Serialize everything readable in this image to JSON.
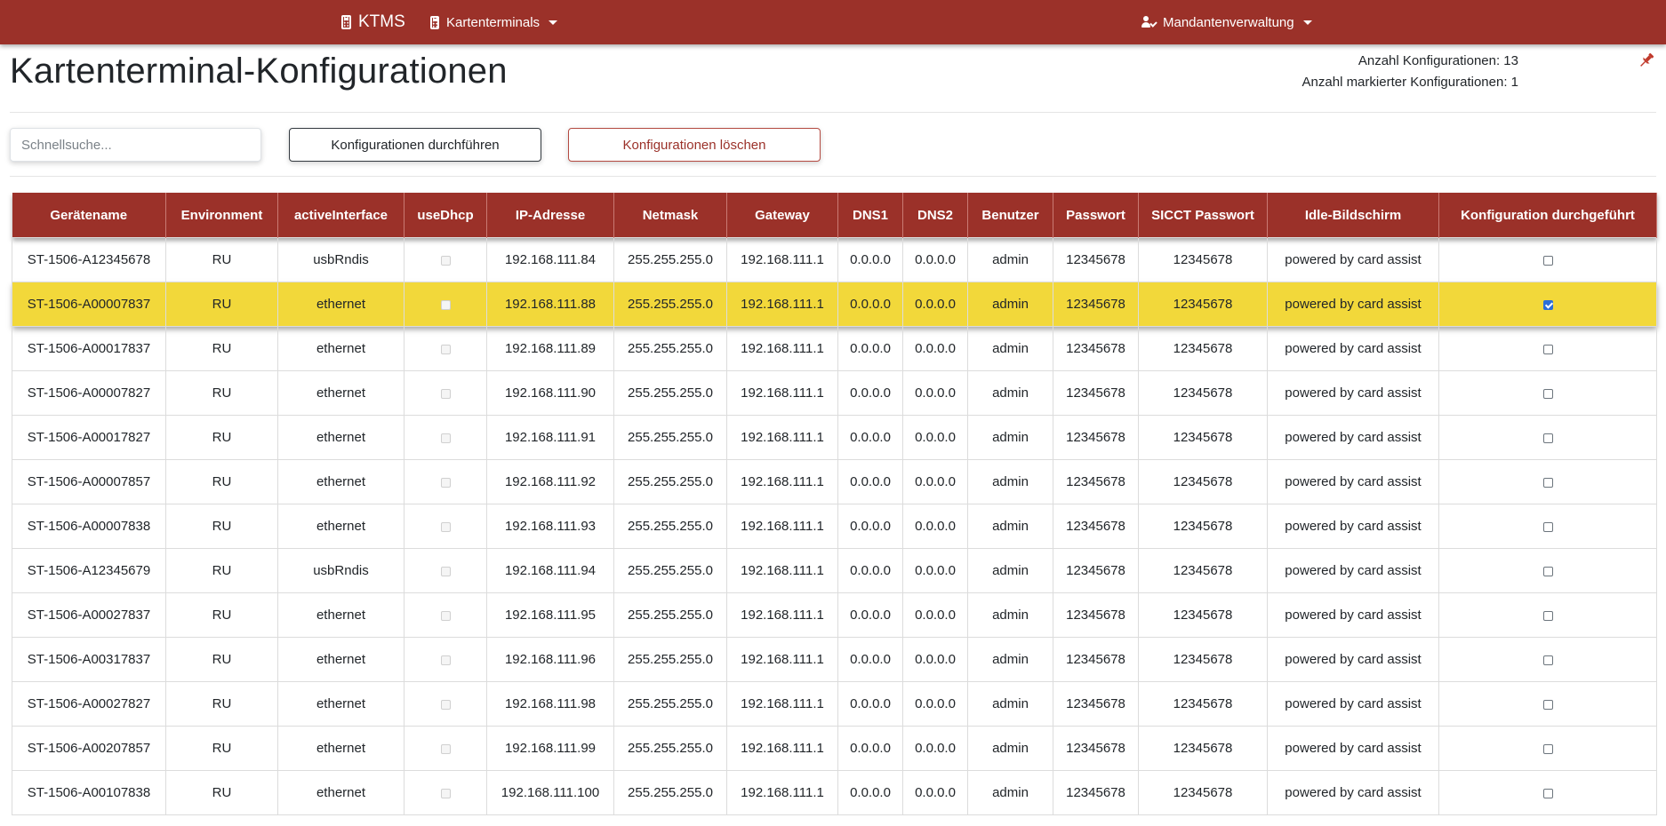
{
  "nav": {
    "brand": "KTMS",
    "kartenterminals": "Kartenterminals",
    "mandantenverwaltung": "Mandantenverwaltung",
    "icons": [
      "calculator-icon",
      "user-check-icon",
      "caret-down-icon"
    ]
  },
  "page": {
    "title": "Kartenterminal-Konfigurationen",
    "count_label": "Anzahl Konfigurationen: 13",
    "marked_label": "Anzahl markierter Konfigurationen: 1"
  },
  "toolbar": {
    "search_placeholder": "Schnellsuche...",
    "run_label": "Konfigurationen durchführen",
    "delete_label": "Konfigurationen löschen"
  },
  "colors": {
    "primary": "#9b3129",
    "highlight": "#f2d83a",
    "checkbox": "#2b6ed8"
  },
  "table": {
    "columns": [
      "Gerätename",
      "Environment",
      "activeInterface",
      "useDhcp",
      "IP-Adresse",
      "Netmask",
      "Gateway",
      "DNS1",
      "DNS2",
      "Benutzer",
      "Passwort",
      "SICCT Passwort",
      "Idle-Bildschirm",
      "Konfiguration durchgeführt"
    ],
    "rows": [
      {
        "name": "ST-1506-A12345678",
        "env": "RU",
        "iface": "usbRndis",
        "ip": "192.168.111.84",
        "mask": "255.255.255.0",
        "gw": "192.168.111.1",
        "dns1": "0.0.0.0",
        "dns2": "0.0.0.0",
        "user": "admin",
        "pw": "12345678",
        "sicct": "12345678",
        "idle": "powered by card assist",
        "done": false,
        "marked": false
      },
      {
        "name": "ST-1506-A00007837",
        "env": "RU",
        "iface": "ethernet",
        "ip": "192.168.111.88",
        "mask": "255.255.255.0",
        "gw": "192.168.111.1",
        "dns1": "0.0.0.0",
        "dns2": "0.0.0.0",
        "user": "admin",
        "pw": "12345678",
        "sicct": "12345678",
        "idle": "powered by card assist",
        "done": true,
        "marked": true
      },
      {
        "name": "ST-1506-A00017837",
        "env": "RU",
        "iface": "ethernet",
        "ip": "192.168.111.89",
        "mask": "255.255.255.0",
        "gw": "192.168.111.1",
        "dns1": "0.0.0.0",
        "dns2": "0.0.0.0",
        "user": "admin",
        "pw": "12345678",
        "sicct": "12345678",
        "idle": "powered by card assist",
        "done": false,
        "marked": false
      },
      {
        "name": "ST-1506-A00007827",
        "env": "RU",
        "iface": "ethernet",
        "ip": "192.168.111.90",
        "mask": "255.255.255.0",
        "gw": "192.168.111.1",
        "dns1": "0.0.0.0",
        "dns2": "0.0.0.0",
        "user": "admin",
        "pw": "12345678",
        "sicct": "12345678",
        "idle": "powered by card assist",
        "done": false,
        "marked": false
      },
      {
        "name": "ST-1506-A00017827",
        "env": "RU",
        "iface": "ethernet",
        "ip": "192.168.111.91",
        "mask": "255.255.255.0",
        "gw": "192.168.111.1",
        "dns1": "0.0.0.0",
        "dns2": "0.0.0.0",
        "user": "admin",
        "pw": "12345678",
        "sicct": "12345678",
        "idle": "powered by card assist",
        "done": false,
        "marked": false
      },
      {
        "name": "ST-1506-A00007857",
        "env": "RU",
        "iface": "ethernet",
        "ip": "192.168.111.92",
        "mask": "255.255.255.0",
        "gw": "192.168.111.1",
        "dns1": "0.0.0.0",
        "dns2": "0.0.0.0",
        "user": "admin",
        "pw": "12345678",
        "sicct": "12345678",
        "idle": "powered by card assist",
        "done": false,
        "marked": false
      },
      {
        "name": "ST-1506-A00007838",
        "env": "RU",
        "iface": "ethernet",
        "ip": "192.168.111.93",
        "mask": "255.255.255.0",
        "gw": "192.168.111.1",
        "dns1": "0.0.0.0",
        "dns2": "0.0.0.0",
        "user": "admin",
        "pw": "12345678",
        "sicct": "12345678",
        "idle": "powered by card assist",
        "done": false,
        "marked": false
      },
      {
        "name": "ST-1506-A12345679",
        "env": "RU",
        "iface": "usbRndis",
        "ip": "192.168.111.94",
        "mask": "255.255.255.0",
        "gw": "192.168.111.1",
        "dns1": "0.0.0.0",
        "dns2": "0.0.0.0",
        "user": "admin",
        "pw": "12345678",
        "sicct": "12345678",
        "idle": "powered by card assist",
        "done": false,
        "marked": false
      },
      {
        "name": "ST-1506-A00027837",
        "env": "RU",
        "iface": "ethernet",
        "ip": "192.168.111.95",
        "mask": "255.255.255.0",
        "gw": "192.168.111.1",
        "dns1": "0.0.0.0",
        "dns2": "0.0.0.0",
        "user": "admin",
        "pw": "12345678",
        "sicct": "12345678",
        "idle": "powered by card assist",
        "done": false,
        "marked": false
      },
      {
        "name": "ST-1506-A00317837",
        "env": "RU",
        "iface": "ethernet",
        "ip": "192.168.111.96",
        "mask": "255.255.255.0",
        "gw": "192.168.111.1",
        "dns1": "0.0.0.0",
        "dns2": "0.0.0.0",
        "user": "admin",
        "pw": "12345678",
        "sicct": "12345678",
        "idle": "powered by card assist",
        "done": false,
        "marked": false
      },
      {
        "name": "ST-1506-A00027827",
        "env": "RU",
        "iface": "ethernet",
        "ip": "192.168.111.98",
        "mask": "255.255.255.0",
        "gw": "192.168.111.1",
        "dns1": "0.0.0.0",
        "dns2": "0.0.0.0",
        "user": "admin",
        "pw": "12345678",
        "sicct": "12345678",
        "idle": "powered by card assist",
        "done": false,
        "marked": false
      },
      {
        "name": "ST-1506-A00207857",
        "env": "RU",
        "iface": "ethernet",
        "ip": "192.168.111.99",
        "mask": "255.255.255.0",
        "gw": "192.168.111.1",
        "dns1": "0.0.0.0",
        "dns2": "0.0.0.0",
        "user": "admin",
        "pw": "12345678",
        "sicct": "12345678",
        "idle": "powered by card assist",
        "done": false,
        "marked": false
      },
      {
        "name": "ST-1506-A00107838",
        "env": "RU",
        "iface": "ethernet",
        "ip": "192.168.111.100",
        "mask": "255.255.255.0",
        "gw": "192.168.111.1",
        "dns1": "0.0.0.0",
        "dns2": "0.0.0.0",
        "user": "admin",
        "pw": "12345678",
        "sicct": "12345678",
        "idle": "powered by card assist",
        "done": false,
        "marked": false
      }
    ]
  }
}
